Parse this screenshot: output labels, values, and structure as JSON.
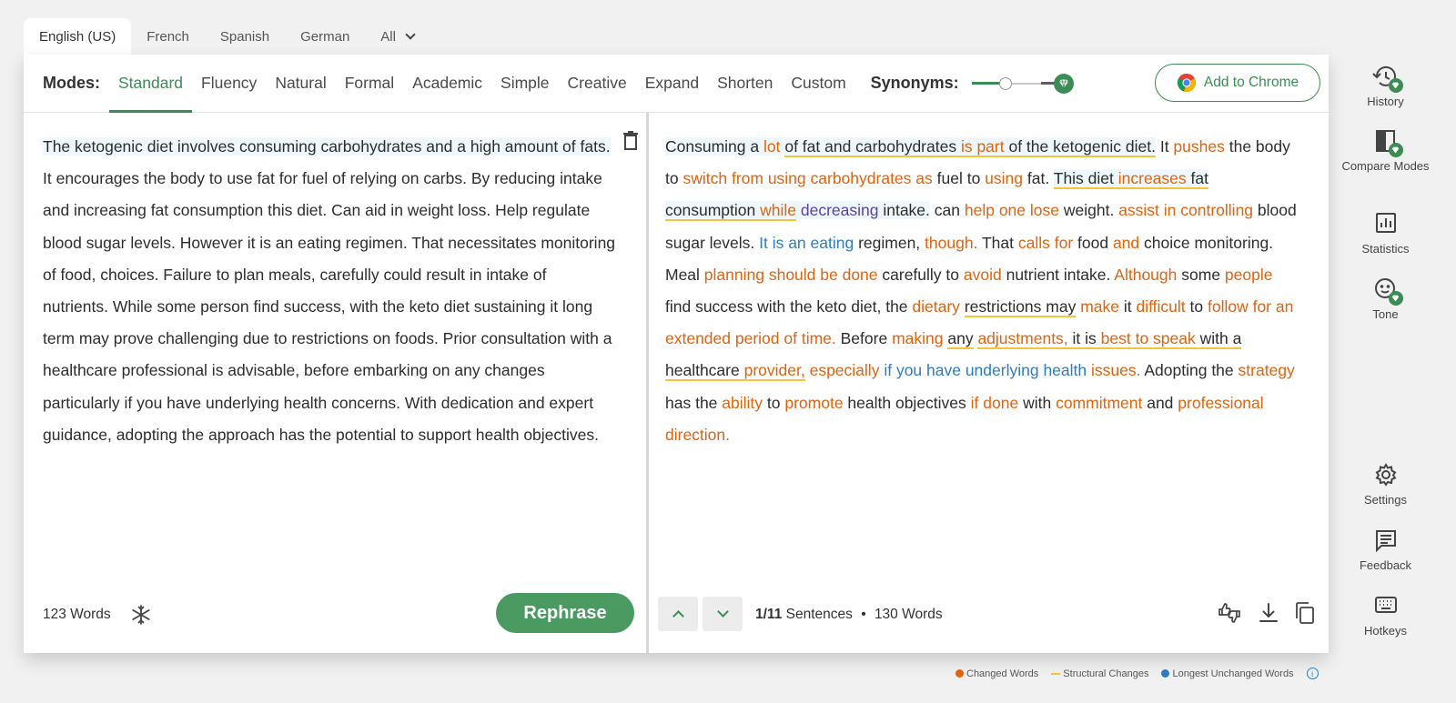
{
  "languages": [
    {
      "label": "English (US)",
      "active": true
    },
    {
      "label": "French"
    },
    {
      "label": "Spanish"
    },
    {
      "label": "German"
    },
    {
      "label": "All"
    }
  ],
  "modes": {
    "label": "Modes:",
    "items": [
      "Standard",
      "Fluency",
      "Natural",
      "Formal",
      "Academic",
      "Simple",
      "Creative",
      "Expand",
      "Shorten",
      "Custom"
    ],
    "active": "Standard"
  },
  "synonyms": {
    "label": "Synonyms:",
    "level": 0.35
  },
  "chrome_button": "Add to Chrome",
  "input": {
    "highlighted": "The ketogenic diet involves consuming carbohydrates and a high amount of fats.",
    "rest": " It encourages the body to use fat for fuel of relying on carbs. By reducing intake and increasing fat consumption this diet. Can aid in weight loss. Help regulate blood sugar levels. However it is an eating regimen. That necessitates monitoring of food, choices. Failure to plan meals, carefully could result in intake of nutrients. While some person find success, with the keto diet sustaining it long term may prove challenging due to restrictions on foods. Prior consultation with a healthcare professional is advisable, before embarking on any changes particularly if you have underlying health concerns. With dedication and expert guidance, adopting the approach has the potential to support health objectives.",
    "word_count": "123 Words"
  },
  "output": {
    "segments": [
      {
        "t": "Consuming a ",
        "h": 1
      },
      {
        "t": "lot",
        "c": "ch",
        "h": 1
      },
      {
        "t": " ",
        "h": 1
      },
      {
        "t": "of fat and carbohydrates ",
        "s": 1,
        "h": 1
      },
      {
        "t": "is part",
        "c": "ch",
        "s": 1,
        "h": 1
      },
      {
        "t": " of the ketogenic diet.",
        "s": 1,
        "h": 1
      },
      {
        "t": " It "
      },
      {
        "t": "pushes",
        "c": "ch"
      },
      {
        "t": " the body to "
      },
      {
        "t": "switch from using carbohydrates as",
        "c": "ch"
      },
      {
        "t": " fuel to "
      },
      {
        "t": "using",
        "c": "ch"
      },
      {
        "t": " fat. "
      },
      {
        "t": "This diet ",
        "s": 1,
        "h": 1
      },
      {
        "t": "increases",
        "c": "ch",
        "s": 1,
        "h": 1
      },
      {
        "t": " fat consumption ",
        "s": 1,
        "h": 1
      },
      {
        "t": "while",
        "c": "ch",
        "s": 1,
        "h": 1
      },
      {
        "t": " ",
        "h": 1
      },
      {
        "t": "decreasing",
        "c": "pu",
        "h": 1
      },
      {
        "t": " intake.",
        "h": 1
      },
      {
        "t": " can "
      },
      {
        "t": "help one lose",
        "c": "ch"
      },
      {
        "t": " weight. "
      },
      {
        "t": "assist in controlling",
        "c": "ch"
      },
      {
        "t": " blood sugar levels. "
      },
      {
        "t": "It is an eating",
        "c": "lu"
      },
      {
        "t": " regimen, "
      },
      {
        "t": "though.",
        "c": "ch"
      },
      {
        "t": " That "
      },
      {
        "t": "calls for",
        "c": "ch"
      },
      {
        "t": " food "
      },
      {
        "t": "and",
        "c": "ch"
      },
      {
        "t": " choice monitoring. Meal "
      },
      {
        "t": "planning should be done",
        "c": "ch"
      },
      {
        "t": " carefully to "
      },
      {
        "t": "avoid",
        "c": "ch"
      },
      {
        "t": " nutrient intake. "
      },
      {
        "t": "Although",
        "c": "ch"
      },
      {
        "t": " some "
      },
      {
        "t": "people",
        "c": "ch"
      },
      {
        "t": " find success with the keto diet, the "
      },
      {
        "t": "dietary",
        "c": "ch"
      },
      {
        "t": " "
      },
      {
        "t": "restrictions may",
        "s": 1
      },
      {
        "t": " "
      },
      {
        "t": "make",
        "c": "ch"
      },
      {
        "t": " it "
      },
      {
        "t": "difficult",
        "c": "ch"
      },
      {
        "t": " to "
      },
      {
        "t": "follow for an extended period of time.",
        "c": "ch"
      },
      {
        "t": " Before "
      },
      {
        "t": "making",
        "c": "ch"
      },
      {
        "t": " "
      },
      {
        "t": "any",
        "s": 1
      },
      {
        "t": " "
      },
      {
        "t": "adjustments,",
        "c": "ch",
        "s": 1
      },
      {
        "t": " it is ",
        "s": 1
      },
      {
        "t": "best to speak",
        "c": "ch",
        "s": 1
      },
      {
        "t": " with a healthcare ",
        "s": 1
      },
      {
        "t": "provider,",
        "c": "ch",
        "s": 1
      },
      {
        "t": " "
      },
      {
        "t": "especially",
        "c": "ch"
      },
      {
        "t": " "
      },
      {
        "t": "if you have underlying health",
        "c": "lu"
      },
      {
        "t": " "
      },
      {
        "t": "issues.",
        "c": "ch"
      },
      {
        "t": " Adopting the "
      },
      {
        "t": "strategy",
        "c": "ch"
      },
      {
        "t": " has the "
      },
      {
        "t": "ability",
        "c": "ch"
      },
      {
        "t": " to "
      },
      {
        "t": "promote",
        "c": "ch"
      },
      {
        "t": " health objectives "
      },
      {
        "t": "if done",
        "c": "ch"
      },
      {
        "t": " with "
      },
      {
        "t": "commitment",
        "c": "ch"
      },
      {
        "t": " and "
      },
      {
        "t": "professional direction.",
        "c": "ch"
      }
    ],
    "sentence_current": "1/11",
    "sentence_label": "Sentences",
    "separator": "•",
    "word_count": "130 Words"
  },
  "legend": {
    "changed": "Changed Words",
    "structural": "Structural Changes",
    "unchanged": "Longest Unchanged Words",
    "info": "i"
  },
  "colors": {
    "accent": "#3d8b55",
    "changed": "#e0630f",
    "structural": "#f7c23c",
    "unchanged": "#2f7bbf"
  },
  "sidebar": [
    {
      "label": "History",
      "icon": "history-icon"
    },
    {
      "label": "Compare Modes",
      "icon": "compare-modes-icon"
    },
    {
      "label": "Statistics",
      "icon": "statistics-icon"
    },
    {
      "label": "Tone",
      "icon": "tone-icon"
    },
    {
      "label": "Settings",
      "icon": "settings-icon"
    },
    {
      "label": "Feedback",
      "icon": "feedback-icon"
    },
    {
      "label": "Hotkeys",
      "icon": "hotkeys-icon"
    }
  ]
}
